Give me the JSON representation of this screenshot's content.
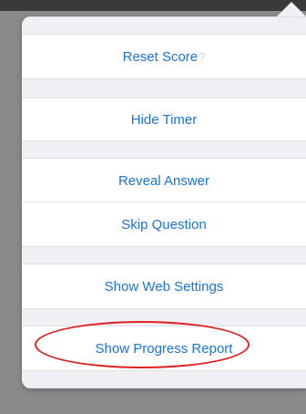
{
  "menu": {
    "items": [
      {
        "label": "Reset Score",
        "suffix": "?"
      },
      {
        "label": "Hide Timer"
      },
      {
        "label": "Reveal Answer"
      },
      {
        "label": "Skip Question"
      },
      {
        "label": "Show Web Settings"
      },
      {
        "label": "Show Progress Report"
      }
    ]
  },
  "colors": {
    "accent": "#1a73d6",
    "highlight_ring": "#e02020",
    "backdrop": "#8a8a8a"
  }
}
